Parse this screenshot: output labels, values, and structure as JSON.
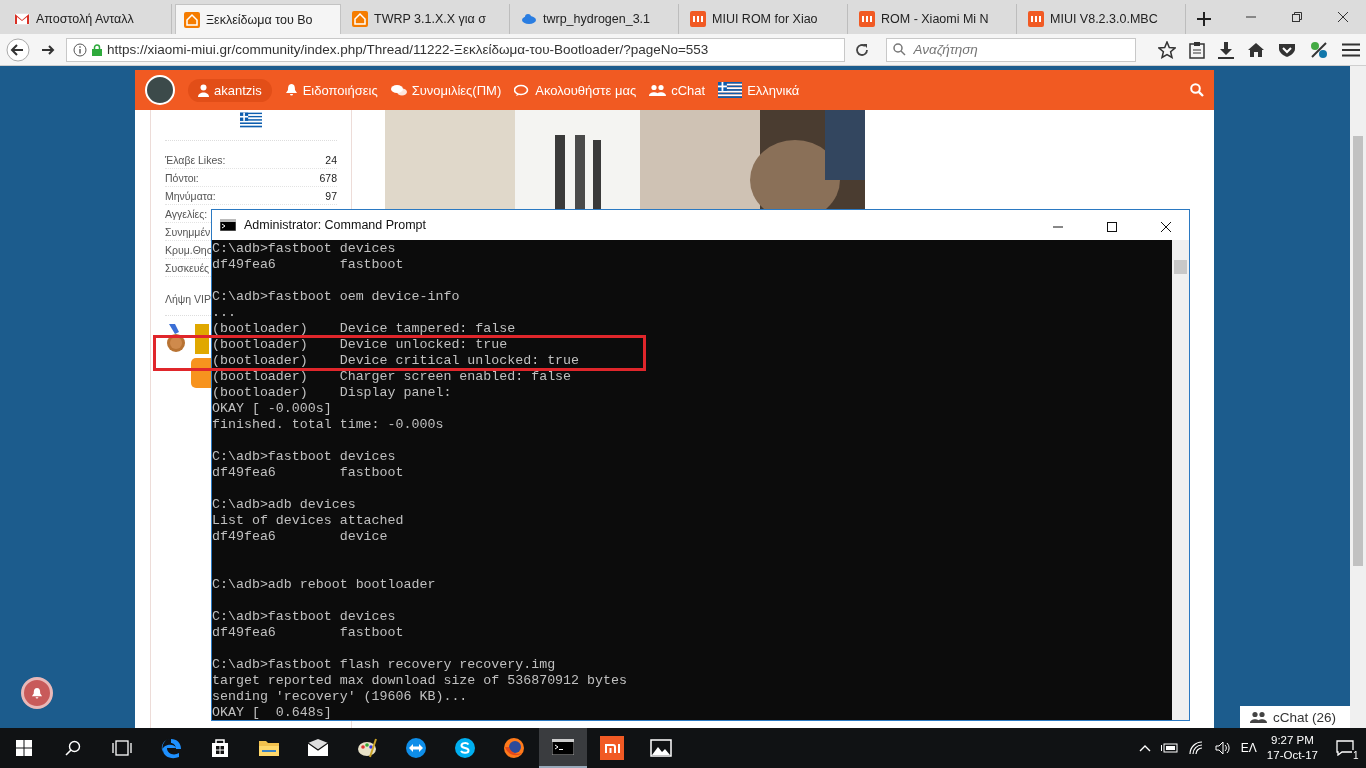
{
  "browser": {
    "tabs": [
      {
        "title": "Αποστολή Ανταλλ",
        "kind": "mail",
        "selected": false
      },
      {
        "title": "Ξεκλείδωμα του Bo",
        "kind": "home",
        "selected": true
      },
      {
        "title": "TWRP 3.1.X.X για σ",
        "kind": "home",
        "selected": false
      },
      {
        "title": "twrp_hydrogen_3.1",
        "kind": "cloud",
        "selected": false
      },
      {
        "title": "MIUI ROM for Xiao",
        "kind": "miui",
        "selected": false
      },
      {
        "title": "ROM - Xiaomi Mi N",
        "kind": "miui",
        "selected": false
      },
      {
        "title": "MIUI V8.2.3.0.MBC",
        "kind": "miui",
        "selected": false
      }
    ],
    "url": "https://xiaomi-miui.gr/community/index.php/Thread/11222-Ξεκλείδωμα-του-Bootloader/?pageNo=553",
    "search": {
      "placeholder": "Αναζήτηση"
    }
  },
  "site": {
    "nav": {
      "user": "akantzis",
      "items": [
        {
          "label": "Ειδοποιήσεις",
          "kind": "bell"
        },
        {
          "label": "Συνομιλίες(ΠΜ)",
          "kind": "chat"
        },
        {
          "label": "Ακολουθήστε μας",
          "kind": "follow"
        },
        {
          "label": "cChat",
          "kind": "users"
        },
        {
          "label": "Ελληνικά",
          "kind": "flag"
        }
      ]
    },
    "profile_stats": [
      {
        "label": "Έλαβε Likes:",
        "value": "24"
      },
      {
        "label": "Πόντοι:",
        "value": "678"
      },
      {
        "label": "Μηνύματα:",
        "value": "97"
      },
      {
        "label": "Αγγελίες:"
      },
      {
        "label": "Συνημμέν"
      },
      {
        "label": "Κρυμ.Θησ"
      },
      {
        "label": "Συσκευές"
      }
    ],
    "vip_label": "Λήψη VIP",
    "chat_button": "cChat (26)"
  },
  "console": {
    "title": "Administrator: Command Prompt",
    "blocks": [
      {
        "extra_gap": false,
        "lines": [
          "C:\\adb>fastboot devices",
          "df49fea6        fastboot"
        ]
      },
      {
        "extra_gap": false,
        "lines": [
          "C:\\adb>fastboot oem device-info",
          "...",
          "(bootloader)    Device tampered: false",
          "(bootloader)    Device unlocked: true",
          "(bootloader)    Device critical unlocked: true",
          "(bootloader)    Charger screen enabled: false",
          "(bootloader)    Display panel:",
          "OKAY [ -0.000s]",
          "finished. total time: -0.000s"
        ]
      },
      {
        "extra_gap": false,
        "lines": [
          "C:\\adb>fastboot devices",
          "df49fea6        fastboot"
        ]
      },
      {
        "extra_gap": false,
        "lines": [
          "C:\\adb>adb devices",
          "List of devices attached",
          "df49fea6        device"
        ]
      },
      {
        "extra_gap": true,
        "lines": [
          "C:\\adb>adb reboot bootloader"
        ]
      },
      {
        "extra_gap": false,
        "lines": [
          "C:\\adb>fastboot devices",
          "df49fea6        fastboot"
        ]
      },
      {
        "extra_gap": false,
        "lines": [
          "C:\\adb>fastboot flash recovery recovery.img",
          "target reported max download size of 536870912 bytes",
          "sending 'recovery' (19606 KB)...",
          "OKAY [  0.648s]"
        ]
      }
    ]
  },
  "taskbar": {
    "apps": [
      {
        "kind": "edge",
        "selected": false
      },
      {
        "kind": "store",
        "selected": false
      },
      {
        "kind": "folder",
        "selected": false
      },
      {
        "kind": "mail",
        "selected": false
      },
      {
        "kind": "paint",
        "selected": false
      },
      {
        "kind": "remote",
        "selected": false
      },
      {
        "kind": "skype",
        "selected": false
      },
      {
        "kind": "firefox",
        "selected": false
      },
      {
        "kind": "console",
        "selected": true
      },
      {
        "kind": "mi",
        "selected": false
      },
      {
        "kind": "photos",
        "selected": false
      }
    ],
    "language": "ΕΛ",
    "time": "9:27 PM",
    "date": "17-Oct-17",
    "notifications": "1"
  }
}
